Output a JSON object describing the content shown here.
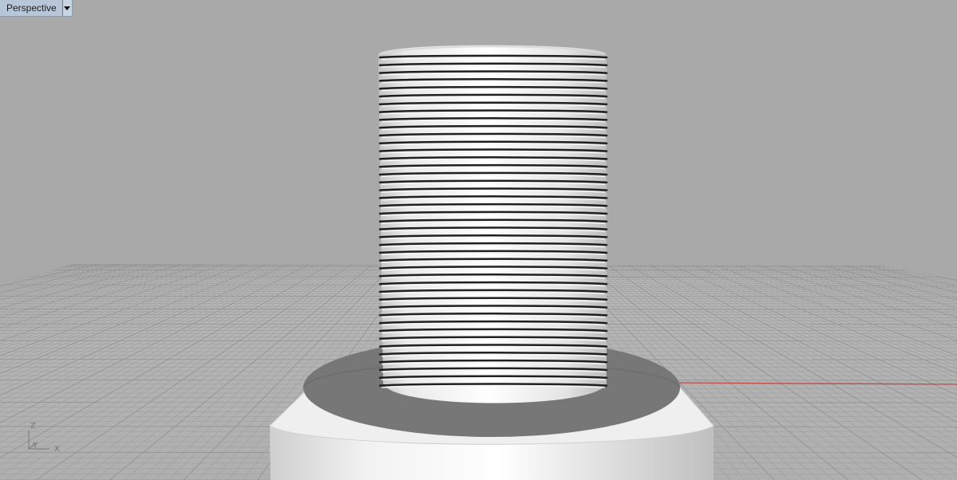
{
  "viewport": {
    "title": "Perspective",
    "dropdown_icon": "chevron-down-icon"
  },
  "axis_widget": {
    "z_label": "Z",
    "y_label": "Y",
    "x_label": "X"
  },
  "colors": {
    "background": "#a9a9a9",
    "grid_fill": "#b4b4b4",
    "grid_line": "#989898",
    "x_axis": "#c44a4a",
    "tab_bg": "#b7c7d8"
  }
}
